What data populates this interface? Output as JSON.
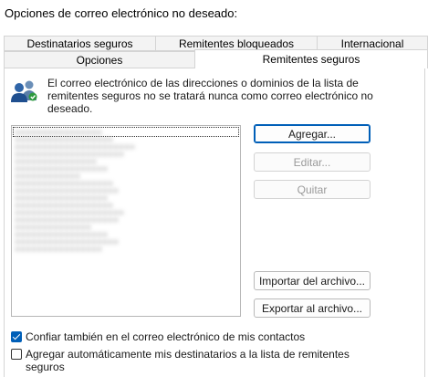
{
  "window": {
    "title": "Opciones de correo electrónico no deseado:"
  },
  "tabs": {
    "back_row": [
      "Destinatarios seguros",
      "Remitentes bloqueados",
      "Internacional"
    ],
    "front_row": [
      "Opciones",
      "Remitentes seguros"
    ],
    "active": "Remitentes seguros"
  },
  "description": "El correo electrónico de las direcciones o dominios de la lista de remitentes seguros no se tratará nunca como correo electrónico no deseado.",
  "icon": "people-icon",
  "sender_list": {
    "obscured": true,
    "entries": [
      "",
      "",
      "",
      "",
      "",
      "",
      "",
      "",
      "",
      "",
      "",
      "",
      "",
      "",
      "",
      "",
      ""
    ]
  },
  "buttons": {
    "add": "Agregar...",
    "edit": "Editar...",
    "remove": "Quitar",
    "import": "Importar del archivo...",
    "export": "Exportar al archivo..."
  },
  "checkboxes": {
    "trust_contacts": {
      "label": "Confiar también en el correo electrónico de mis contactos",
      "checked": true
    },
    "auto_add_recipients": {
      "label": "Agregar automáticamente mis destinatarios a la lista de remitentes seguros",
      "checked": false
    }
  },
  "colors": {
    "accent": "#005fb8",
    "tab_inactive": "#f3f3f3",
    "border": "#d4d4d4"
  }
}
